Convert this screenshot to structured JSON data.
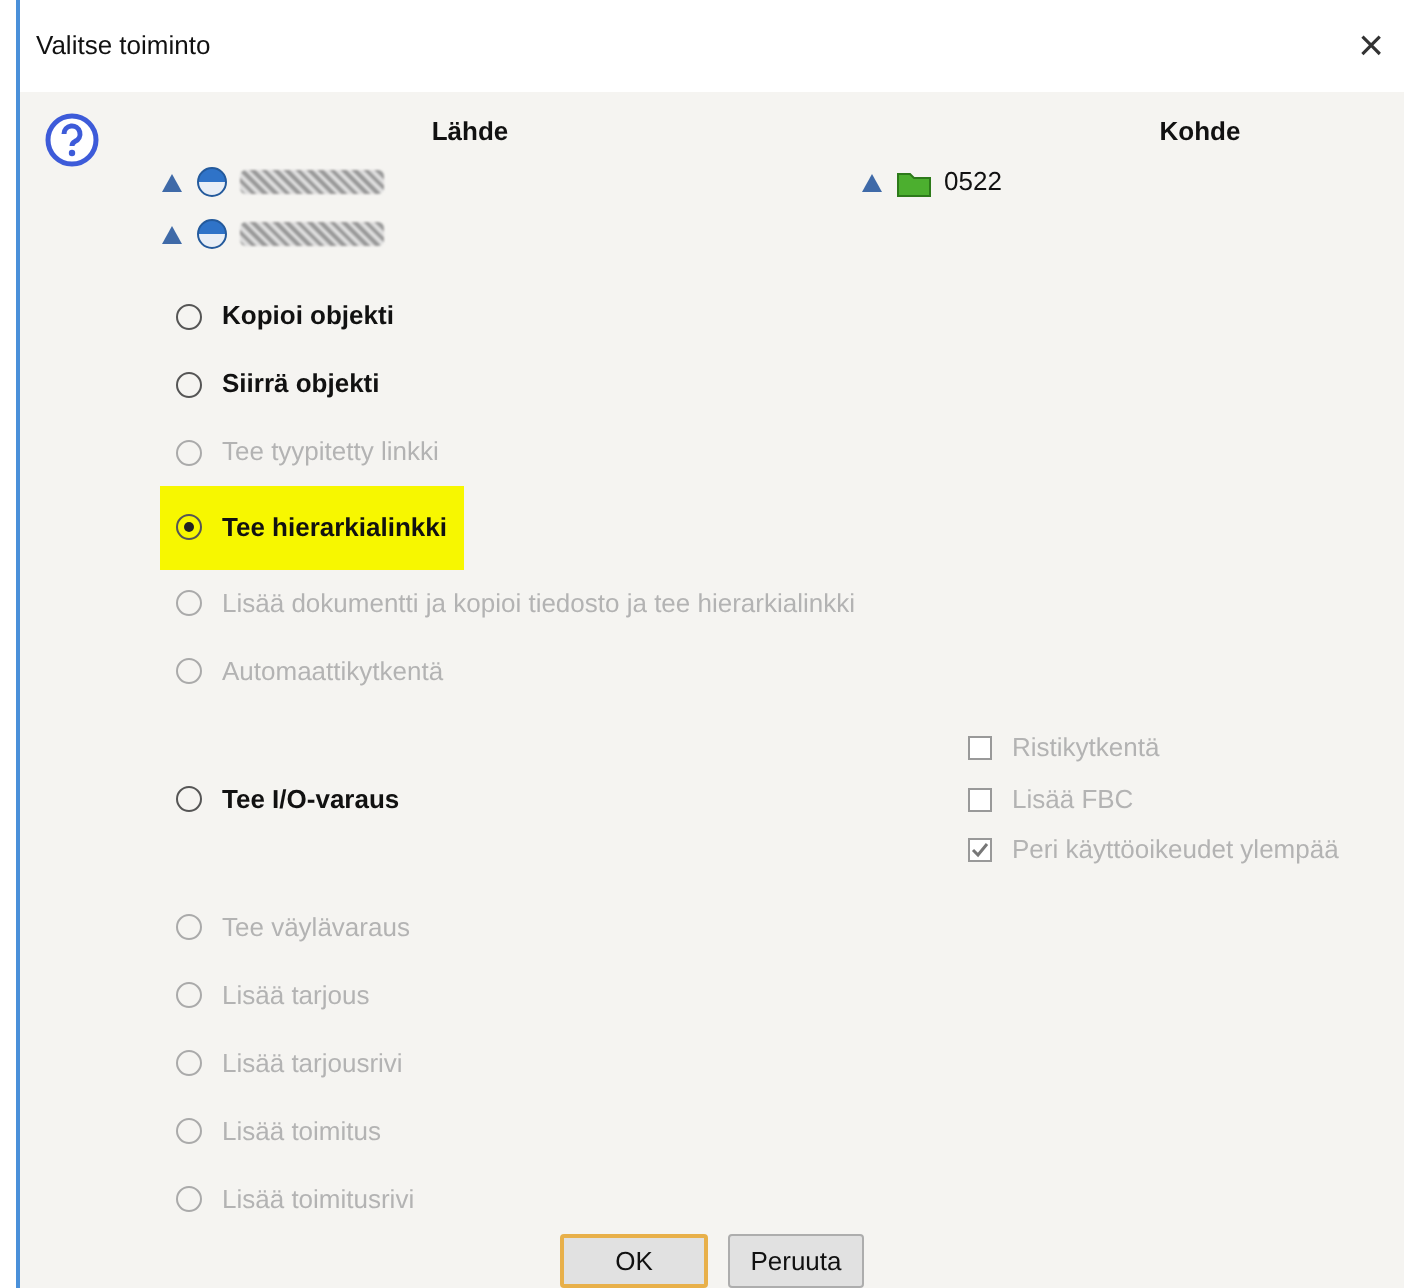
{
  "window": {
    "title": "Valitse toiminto",
    "close": "×"
  },
  "source": {
    "heading": "Lähde",
    "items": [
      {
        "redacted": true
      },
      {
        "redacted": true
      }
    ]
  },
  "target": {
    "heading": "Kohde",
    "items": [
      {
        "label": "0522"
      }
    ]
  },
  "options": [
    {
      "label": "Kopioi objekti",
      "selected": false,
      "disabled": false,
      "highlighted": false
    },
    {
      "label": "Siirrä objekti",
      "selected": false,
      "disabled": false,
      "highlighted": false
    },
    {
      "label": "Tee tyypitetty linkki",
      "selected": false,
      "disabled": true,
      "highlighted": false
    },
    {
      "label": "Tee hierarkialinkki",
      "selected": true,
      "disabled": false,
      "highlighted": true
    },
    {
      "label": "Lisää dokumentti ja kopioi tiedosto ja tee hierarkialinkki",
      "selected": false,
      "disabled": true,
      "highlighted": false
    },
    {
      "label": "Automaattikytkentä",
      "selected": false,
      "disabled": true,
      "highlighted": false
    },
    {
      "label": "Tee I/O-varaus",
      "selected": false,
      "disabled": false,
      "highlighted": false,
      "checkboxes": [
        {
          "label": "Ristikytkentä",
          "checked": false,
          "disabled": true
        },
        {
          "label": "Lisää FBC",
          "checked": false,
          "disabled": true
        },
        {
          "label": "Peri käyttöoikeudet ylempää",
          "checked": true,
          "disabled": true
        }
      ]
    },
    {
      "label": "Tee väylävaraus",
      "selected": false,
      "disabled": true,
      "highlighted": false
    },
    {
      "label": "Lisää tarjous",
      "selected": false,
      "disabled": true,
      "highlighted": false
    },
    {
      "label": "Lisää tarjousrivi",
      "selected": false,
      "disabled": true,
      "highlighted": false
    },
    {
      "label": "Lisää toimitus",
      "selected": false,
      "disabled": true,
      "highlighted": false
    },
    {
      "label": "Lisää toimitusrivi",
      "selected": false,
      "disabled": true,
      "highlighted": false
    }
  ],
  "buttons": [
    {
      "label": "OK",
      "default": true
    },
    {
      "label": "Peruuta",
      "default": false
    }
  ]
}
